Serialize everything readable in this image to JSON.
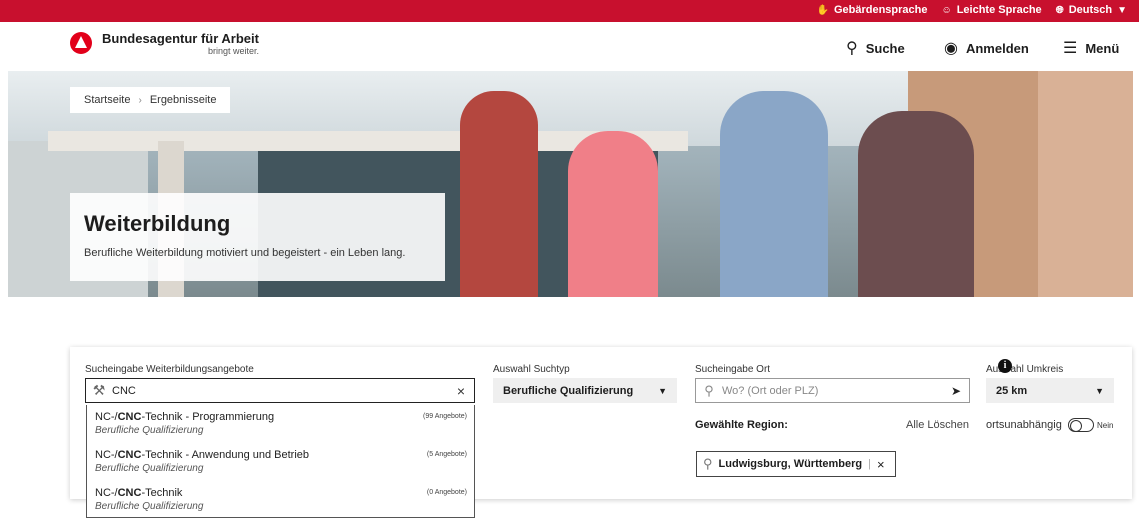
{
  "utility": {
    "sign_language": "Gebärdensprache",
    "easy_language": "Leichte Sprache",
    "language": "Deutsch"
  },
  "header": {
    "brand_name": "Bundesagentur für Arbeit",
    "brand_claim": "bringt weiter.",
    "search_label": "Suche",
    "login_label": "Anmelden",
    "menu_label": "Menü"
  },
  "breadcrumb": {
    "home": "Startseite",
    "current": "Ergebnisseite"
  },
  "hero": {
    "title": "Weiterbildung",
    "subtitle": "Berufliche Weiterbildung motiviert und begeistert - ein Leben lang."
  },
  "search": {
    "query_label": "Sucheingabe Weiterbildungsangebote",
    "query_value": "CNC",
    "type_label": "Auswahl Suchtyp",
    "type_value": "Berufliche Qualifizierung",
    "location_label": "Sucheingabe Ort",
    "location_placeholder": "Wo? (Ort oder PLZ)",
    "radius_label": "Auswahl Umkreis",
    "radius_value": "25 km",
    "region_label": "Gewählte Region:",
    "clear_all": "Alle Löschen",
    "location_independent": "ortsunabhängig",
    "toggle_state": "Nein",
    "selected_region": "Ludwigsburg, Württemberg"
  },
  "suggestions": [
    {
      "prefix": "NC-/",
      "match": "CNC",
      "suffix": "-Technik - Programmierung",
      "category": "Berufliche Qualifizierung",
      "count": "(99 Angebote)"
    },
    {
      "prefix": "NC-/",
      "match": "CNC",
      "suffix": "-Technik - Anwendung und Betrieb",
      "category": "Berufliche Qualifizierung",
      "count": "(5 Angebote)"
    },
    {
      "prefix": "NC-/",
      "match": "CNC",
      "suffix": "-Technik",
      "category": "Berufliche Qualifizierung",
      "count": "(0 Angebote)"
    }
  ],
  "colors": {
    "brand_red": "#c8102e",
    "logo_red": "#e2001a"
  }
}
